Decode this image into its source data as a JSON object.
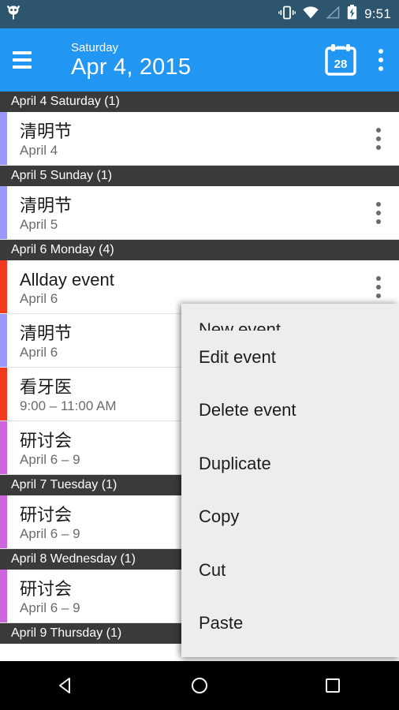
{
  "status_bar": {
    "background": "#2d556e",
    "notification_icon": "android-app-notification-icon",
    "icons": [
      "vibrate-icon",
      "wifi-icon",
      "cell-signal-icon",
      "battery-charging-icon"
    ],
    "time": "9:51"
  },
  "toolbar": {
    "background": "#2196f3",
    "menu_icon": "hamburger-menu-icon",
    "weekday": "Saturday",
    "date": "Apr 4, 2015",
    "today_icon_label": "28",
    "overflow_icon": "overflow-menu-icon"
  },
  "agenda": {
    "sections": [
      {
        "header": "April 4 Saturday (1)",
        "events": [
          {
            "title": "清明节",
            "subtitle": "April 4",
            "color": "#9999ff",
            "has_overflow": true
          }
        ]
      },
      {
        "header": "April 5 Sunday (1)",
        "events": [
          {
            "title": "清明节",
            "subtitle": "April 5",
            "color": "#9999ff",
            "has_overflow": true
          }
        ]
      },
      {
        "header": "April 6 Monday (4)",
        "events": [
          {
            "title": "Allday event",
            "subtitle": "April 6",
            "color": "#f43a1e",
            "has_overflow": true
          },
          {
            "title": "清明节",
            "subtitle": "April 6",
            "color": "#9999ff",
            "has_overflow": false
          },
          {
            "title": "看牙医",
            "subtitle": "9:00 – 11:00 AM",
            "color": "#f43a1e",
            "has_overflow": false
          },
          {
            "title": "研讨会",
            "subtitle": "April 6 – 9",
            "color": "#cc66dd",
            "has_overflow": false
          }
        ]
      },
      {
        "header": "April 7 Tuesday (1)",
        "events": [
          {
            "title": "研讨会",
            "subtitle": "April 6 – 9",
            "color": "#cc66dd",
            "has_overflow": false
          }
        ]
      },
      {
        "header": "April 8 Wednesday (1)",
        "events": [
          {
            "title": "研讨会",
            "subtitle": "April 6 – 9",
            "color": "#cc66dd",
            "has_overflow": false
          }
        ]
      },
      {
        "header": "April 9 Thursday (1)",
        "events": []
      }
    ]
  },
  "context_menu": {
    "background": "#ededed",
    "items": [
      {
        "label": "New event",
        "clipped": true
      },
      {
        "label": "Edit event",
        "clipped": false
      },
      {
        "label": "Delete event",
        "clipped": false
      },
      {
        "label": "Duplicate",
        "clipped": false
      },
      {
        "label": "Copy",
        "clipped": false
      },
      {
        "label": "Cut",
        "clipped": false
      },
      {
        "label": "Paste",
        "clipped": false
      }
    ]
  },
  "nav_bar": {
    "back_icon": "back-triangle-icon",
    "home_icon": "home-circle-icon",
    "recents_icon": "recents-square-icon"
  }
}
